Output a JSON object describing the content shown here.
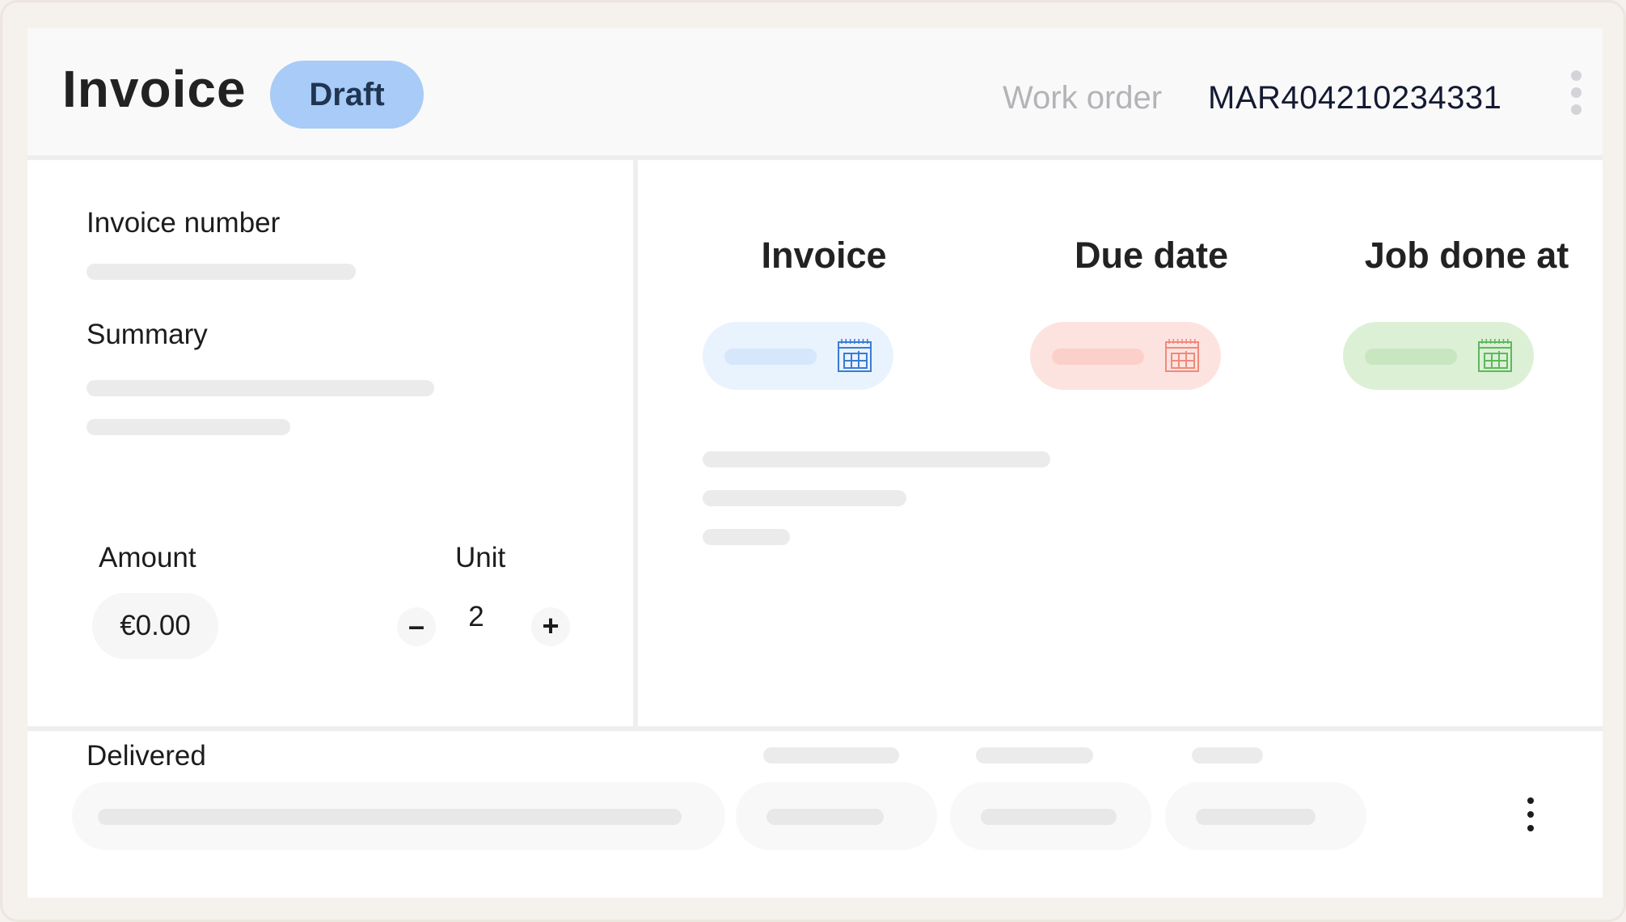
{
  "header": {
    "title": "Invoice",
    "status_badge": "Draft",
    "work_order_label": "Work order",
    "work_order_value": "MAR404210234331",
    "menu_icon": "vertical-dots-icon"
  },
  "left_panel": {
    "invoice_number_label": "Invoice number",
    "summary_label": "Summary",
    "amount_label": "Amount",
    "amount_value": "€0.00",
    "unit_label": "Unit",
    "unit_value": "2",
    "decrement_symbol": "–",
    "increment_symbol": "+"
  },
  "right_panel": {
    "columns": [
      {
        "title": "Invoice",
        "color": "#e9f3fe",
        "bar_color": "#d6e6fb",
        "icon_color": "#3a7bd5",
        "icon": "calendar-icon"
      },
      {
        "title": "Due date",
        "color": "#fde3df",
        "bar_color": "#fbd0ca",
        "icon_color": "#f08a7a",
        "icon": "calendar-icon"
      },
      {
        "title": "Job done at",
        "color": "#dcf0d6",
        "bar_color": "#c8e6bf",
        "icon_color": "#5cb85c",
        "icon": "calendar-icon"
      }
    ]
  },
  "bottom": {
    "delivered_label": "Delivered",
    "row_menu_icon": "vertical-dots-icon"
  },
  "colors": {
    "page_background": "#f5f1ed",
    "badge": "#a8cbf7",
    "skeleton": "#ebebeb"
  }
}
